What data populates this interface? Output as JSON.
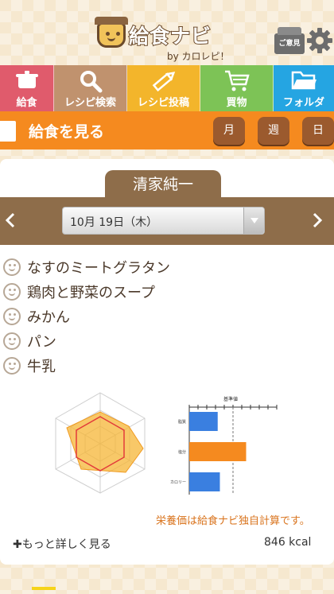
{
  "header": {
    "app_title": "給食ナビ",
    "app_subtitle": "by カロレピ！",
    "opinion_label": "ご意見"
  },
  "nav": [
    {
      "label": "給食",
      "icon": "pot-icon",
      "color": "#e05b6c"
    },
    {
      "label": "レシピ検索",
      "icon": "search-icon",
      "color": "#c0926e"
    },
    {
      "label": "レシピ投稿",
      "icon": "pencil-icon",
      "color": "#f3b52b"
    },
    {
      "label": "買物",
      "icon": "cart-icon",
      "color": "#7dc356"
    },
    {
      "label": "フォルダ",
      "icon": "folder-icon",
      "color": "#25a5e2"
    }
  ],
  "section": {
    "title": "給食を見る",
    "period_buttons": [
      "月",
      "週",
      "日"
    ]
  },
  "school": {
    "name": "清家純一"
  },
  "date_select": {
    "value": "10月 19日（木）"
  },
  "menu_items": [
    "なすのミートグラタン",
    "鶏肉と野菜のスープ",
    "みかん",
    "パン",
    "牛乳"
  ],
  "nutrition": {
    "bar_title": "基準値",
    "bar_labels": [
      "脂質",
      "塩分",
      "カロリー"
    ],
    "note": "栄養価は給食ナビ独自計算です。",
    "more_label": "✚もっと詳しく見る",
    "kcal": "846 kcal"
  },
  "chart_data": {
    "type": "bar",
    "categories": [
      "脂質",
      "塩分",
      "カロリー"
    ],
    "values": [
      0.65,
      1.3,
      0.7
    ],
    "colors": [
      "#3a7fe0",
      "#f58a1f",
      "#3a7fe0"
    ],
    "reference_line": 1.0
  }
}
